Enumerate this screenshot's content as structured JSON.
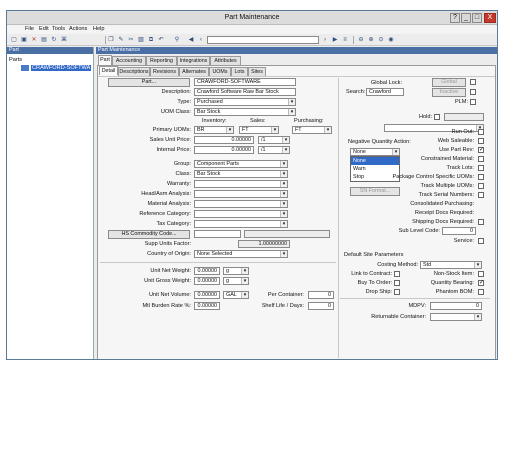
{
  "window": {
    "title": "Part Maintenance",
    "controls": {
      "help": "?",
      "minimize": "_",
      "maximize": "□",
      "close": "X"
    }
  },
  "menu": [
    "File",
    "Edit",
    "Tools",
    "Actions",
    "Help"
  ],
  "left_pane": {
    "header": "Part",
    "tree_root": "Parts",
    "tree_item": "CRAWFORD-SOFTWA"
  },
  "right_pane": {
    "header": "Part Maintenance"
  },
  "tabs_top": [
    "Part",
    "Accounting",
    "Reporting",
    "Integrations",
    "Attributes"
  ],
  "tabs_sub": [
    "Detail",
    "Descriptions",
    "Revisions",
    "Alternates",
    "UOMs",
    "Lots",
    "Sites"
  ],
  "form": {
    "part_button": "Part...",
    "part_value": "CRAWFORD-SOFTWARE",
    "description_label": "Description:",
    "description_value": "Crawford Software Raw Bar Stock",
    "type_label": "Type:",
    "type_value": "Purchased",
    "uom_class_label": "UOM Class:",
    "uom_class_value": "Bar Stock",
    "col_inventory": "Inventory:",
    "col_sales": "Sales:",
    "col_purchasing": "Purchasing:",
    "primary_uoms_label": "Primary UOMs:",
    "uom_inventory": "BR",
    "uom_sales": "FT",
    "uom_purchasing": "FT",
    "sales_unit_price_label": "Sales Unit Price:",
    "sales_unit_price": "0.00000",
    "sales_price_per": "/1",
    "internal_price_label": "Internal Price:",
    "internal_price": "0.00000",
    "internal_price_per": "/1",
    "group_label": "Group:",
    "group_value": "Component Parts",
    "class_label": "Class:",
    "class_value": "Bar Stock",
    "warranty_label": "Warranty:",
    "head_asm_label": "Head/Asm Analysis:",
    "material_analysis_label": "Material Analysis:",
    "reference_category_label": "Reference Category:",
    "tax_category_label": "Tax Category:",
    "hs_commodity_button": "HS Commodity Code...",
    "supp_units_factor_label": "Supp Units Factor:",
    "supp_units_factor": "1.00000000",
    "country_origin_label": "Country of Origin:",
    "country_origin_value": "None Selected",
    "unit_net_weight_label": "Unit Net Weight:",
    "unit_net_weight": "0.00000",
    "unit_net_weight_uom": "g",
    "unit_gross_weight_label": "Unit Gross Weight:",
    "unit_gross_weight": "0.00000",
    "unit_gross_weight_uom": "g",
    "unit_net_volume_label": "Unit Net Volume:",
    "unit_net_volume": "0.00000",
    "unit_net_volume_uom": "GAL",
    "per_container_label": "Per Container:",
    "per_container": "0",
    "mtl_burden_label": "Mtl Burden Rate %:",
    "mtl_burden": "0.00000",
    "shelf_life_label": "Shelf Life / Days:",
    "shelf_life": "0"
  },
  "right_section": {
    "global_lock_label": "Global Lock:",
    "global_button": "Global",
    "search_label": "Search:",
    "search_value": "Crawford",
    "inactive_button": "Inactive",
    "plm_label": "PLM:",
    "hold_label": "Hold:",
    "neg_qty_label": "Negative Quantity Action:",
    "neg_qty_value": "None",
    "neg_qty_options": [
      "None",
      "Warn",
      "Stop"
    ],
    "sn_format_button": "SN Format...",
    "run_out_label": "Run Out:",
    "web_saleable_label": "Web Saleable:",
    "use_part_rev_label": "Use Part Rev:",
    "constrained_material_label": "Constrained Material:",
    "track_lots_label": "Track Lots:",
    "package_control_label": "Package Control Specific UOMs:",
    "track_multiple_uoms_label": "Track Multiple UOMs:",
    "track_serial_label": "Track Serial Numbers:",
    "consolidated_purchasing_label": "Consolidated Purchasing:",
    "receipt_docs_label": "Receipt Docs Required:",
    "shipping_docs_label": "Shipping Docs Required:",
    "sub_level_code_label": "Sub Level Code:",
    "sub_level_code": "0",
    "service_label": "Service:",
    "default_site_label": "Default Site Parameters",
    "costing_method_label": "Costing Method:",
    "costing_method": "Std",
    "link_contract_label": "Link to Contract:",
    "non_stock_label": "Non-Stock Item:",
    "buy_to_order_label": "Buy To Order:",
    "quantity_bearing_label": "Quantity Bearing:",
    "drop_ship_label": "Drop Ship:",
    "phantom_bom_label": "Phantom BOM:",
    "mdpv_label": "MDPV:",
    "mdpv": "0",
    "returnable_container_label": "Returnable Container:"
  },
  "checks": {
    "use_part_rev": "✓",
    "quantity_bearing": "✓"
  }
}
